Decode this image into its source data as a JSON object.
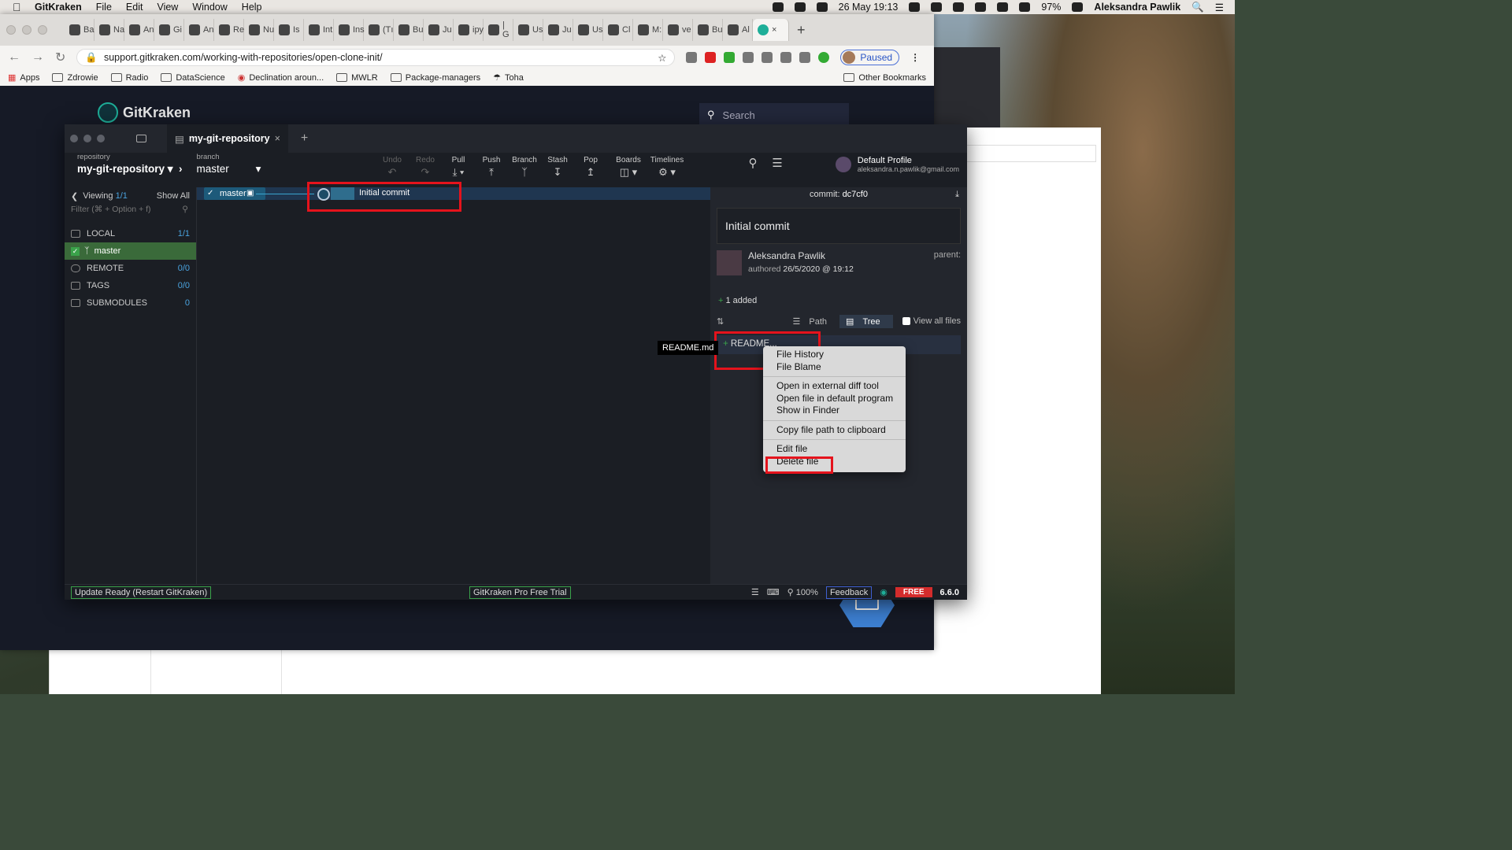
{
  "menubar": {
    "app": "GitKraken",
    "items": [
      "File",
      "Edit",
      "View",
      "Window",
      "Help"
    ],
    "battery": "97%",
    "datetime": "26 May 19:13",
    "user": "Aleksandra Pawlik"
  },
  "browser": {
    "tabs": [
      "Ba",
      "Na",
      "An",
      "Gi",
      "An",
      "Re",
      "Nu",
      "Is",
      "Int",
      "Ins",
      "(Tı",
      "Bu",
      "Ju",
      "ipy",
      "| G",
      "Us",
      "Ju",
      "Us",
      "Cl",
      "M:",
      "ve",
      "Bu",
      "Al"
    ],
    "url": "support.gitkraken.com/working-with-repositories/open-clone-init/",
    "paused": "Paused",
    "bookmarks": [
      "Apps",
      "Zdrowie",
      "Radio",
      "DataScience",
      "Declination aroun...",
      "MWLR",
      "Package-managers",
      "Toha"
    ],
    "other_bookmarks": "Other Bookmarks"
  },
  "site": {
    "logo": "GitKraken",
    "search_placeholder": "Search"
  },
  "gk": {
    "tab": "my-git-repository",
    "repo_label": "repository",
    "repo": "my-git-repository",
    "branch_label": "branch",
    "branch": "master",
    "tools": [
      "Undo",
      "Redo",
      "Pull",
      "Push",
      "Branch",
      "Stash",
      "Pop",
      "Boards",
      "Timelines"
    ],
    "profile_name": "Default Profile",
    "profile_email": "aleksandra.n.pawlik@gmail.com",
    "viewing": "Viewing",
    "viewing_count": "1/1",
    "show_all": "Show All",
    "filter_placeholder": "Filter (⌘ + Option + f)",
    "sidebar": [
      {
        "label": "LOCAL",
        "count": "1/1"
      },
      {
        "label": "master",
        "count": ""
      },
      {
        "label": "REMOTE",
        "count": "0/0"
      },
      {
        "label": "TAGS",
        "count": "0/0"
      },
      {
        "label": "SUBMODULES",
        "count": "0"
      }
    ],
    "graph_branch": "master",
    "commit_message": "Initial commit",
    "commit_id_label": "commit:",
    "commit_id": "dc7cf0",
    "detail_message": "Initial commit",
    "author": "Aleksandra Pawlik",
    "authored": "authored",
    "date": "26/5/2020 @ 19:12",
    "parent": "parent:",
    "added": "1 added",
    "path": "Path",
    "tree": "Tree",
    "view_all_files": "View all files",
    "file": "README.md",
    "file_row": "README...",
    "tooltip": "README.md",
    "context_menu": {
      "group1": [
        "File History",
        "File Blame"
      ],
      "group2": [
        "Open in external diff tool",
        "Open file in default program",
        "Show in Finder"
      ],
      "group3": [
        "Copy file path to clipboard"
      ],
      "group4": [
        "Edit file",
        "Delete file"
      ]
    },
    "status": {
      "update": "Update Ready (Restart GitKraken)",
      "trial": "GitKraken Pro Free Trial",
      "zoom": "100%",
      "feedback": "Feedback",
      "free": "FREE",
      "version": "6.6.0"
    }
  }
}
